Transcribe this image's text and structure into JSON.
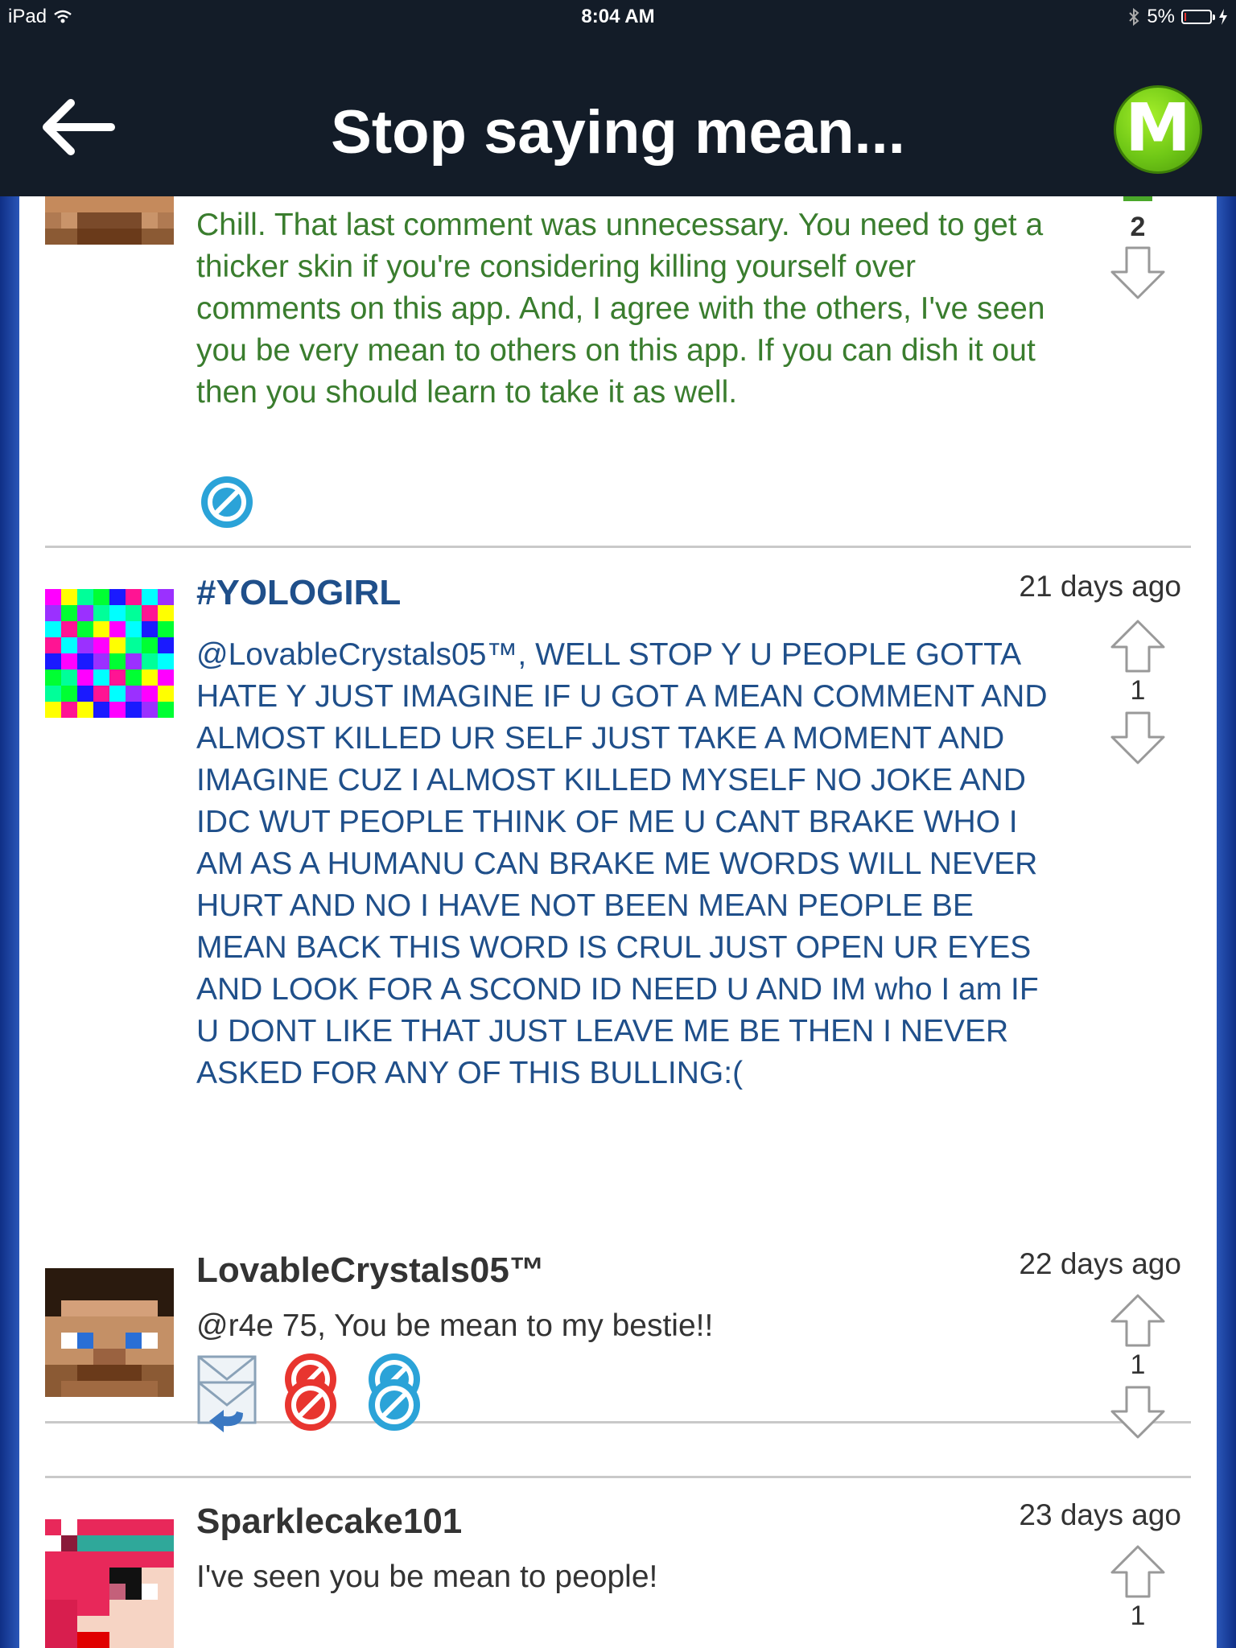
{
  "status_bar": {
    "device": "iPad",
    "time": "8:04 AM",
    "battery": "5%",
    "battery_level": 0.05
  },
  "nav": {
    "title": "Stop saying mean...",
    "logo_letter": "M",
    "accent": "#6fc716"
  },
  "comments": [
    {
      "author": "",
      "time": "",
      "body": "Chill. That last comment was unnecessary. You need to get a thicker skin if you're considering killing yourself over comments on this app. And, I agree with the others, I've seen you be very mean to others on this app. If you can dish it out then you should learn to take it as well.",
      "score": "2",
      "color": "#3a7d2e"
    },
    {
      "author": "#YOLOGIRL",
      "time": "21 days ago",
      "body": "@LovableCrystals05™, WELL STOP Y U PEOPLE GOTTA HATE Y JUST IMAGINE IF U GOT A MEAN COMMENT AND ALMOST KILLED UR SELF JUST TAKE A MOMENT AND IMAGINE CUZ I ALMOST KILLED MYSELF NO JOKE AND IDC WUT PEOPLE THINK OF ME U CANT BRAKE WHO I AM AS A HUMANU CAN BRAKE ME WORDS WILL NEVER HURT AND NO I HAVE NOT BEEN MEAN PEOPLE BE MEAN BACK THIS WORD IS CRUL JUST OPEN UR EYES AND LOOK FOR A SCOND ID NEED U AND IM who I am IF U DONT LIKE THAT JUST LEAVE ME BE THEN I NEVER ASKED FOR ANY OF THIS BULLING:(",
      "score": "1",
      "color": "#1f4f8a"
    },
    {
      "author": "LovableCrystals05™",
      "time": "22 days ago",
      "body": "@r4e 75, You be mean to my bestie!!",
      "score": "1",
      "color": "#333333"
    },
    {
      "author": "Sparklecake101",
      "time": "23 days ago",
      "body": "I've seen you be mean to people!",
      "score": "1",
      "color": "#333333"
    }
  ],
  "icons": {
    "back": "arrow-left-icon",
    "upvote": "arrow-up-icon",
    "downvote": "arrow-down-icon",
    "reply": "reply-envelope-icon",
    "report": "report-icon",
    "block": "block-icon"
  }
}
